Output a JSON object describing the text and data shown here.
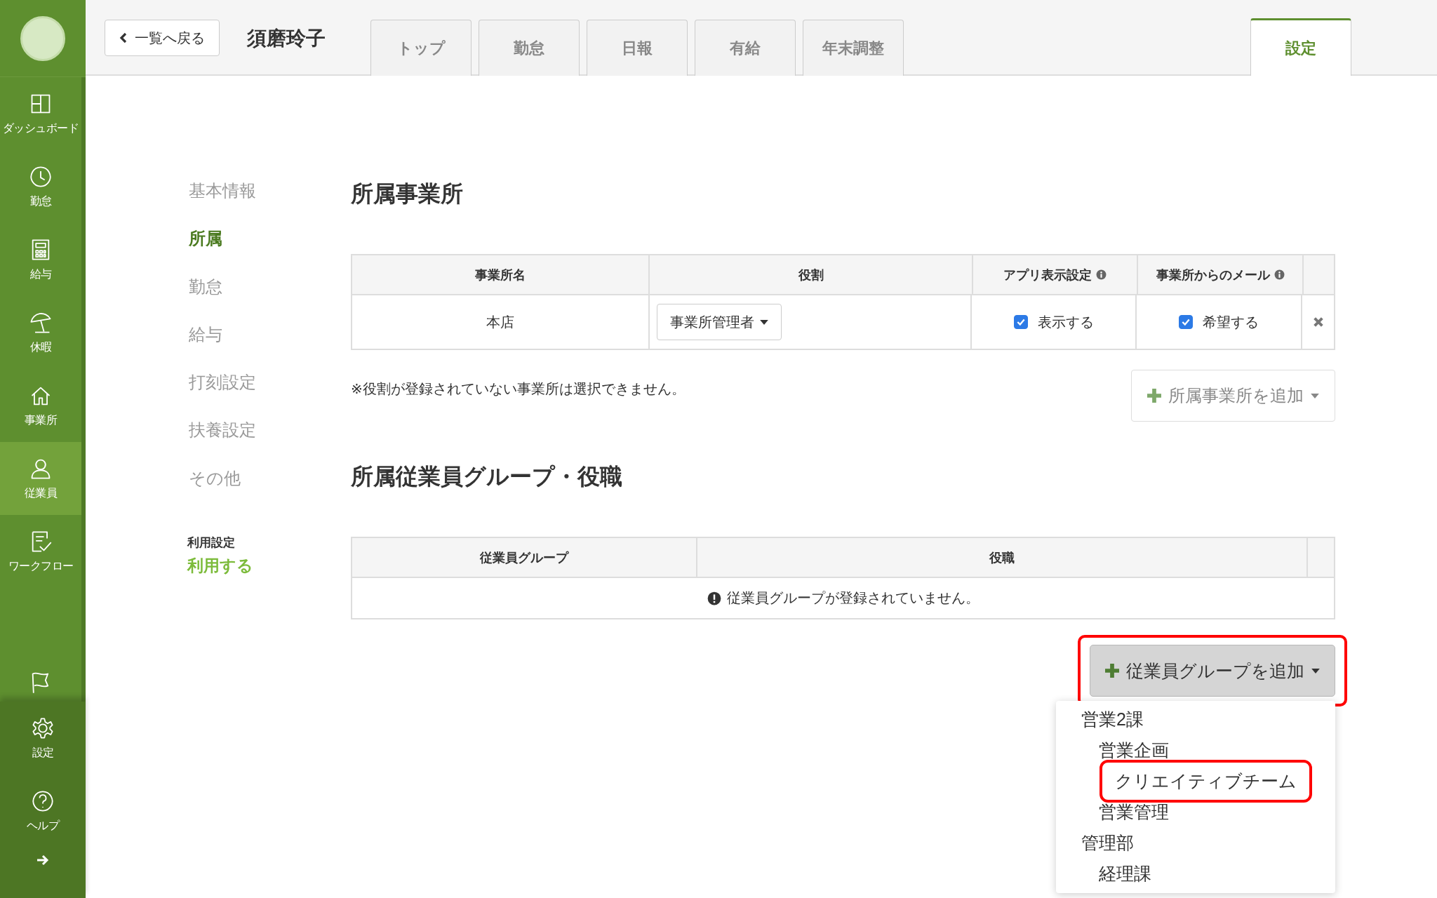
{
  "sidebar": {
    "items": [
      {
        "label": "ダッシュボード",
        "selected": false
      },
      {
        "label": "勤怠",
        "selected": false
      },
      {
        "label": "給与",
        "selected": false
      },
      {
        "label": "休暇",
        "selected": false
      },
      {
        "label": "事業所",
        "selected": false
      },
      {
        "label": "従業員",
        "selected": true
      },
      {
        "label": "ワークフロー",
        "selected": false
      }
    ],
    "bottom_items": [
      {
        "label": "設定"
      },
      {
        "label": "ヘルプ"
      }
    ]
  },
  "header": {
    "back_button": "一覧へ戻る",
    "employee_name": "須磨玲子",
    "tabs": [
      {
        "label": "トップ",
        "selected": false
      },
      {
        "label": "勤怠",
        "selected": false
      },
      {
        "label": "日報",
        "selected": false
      },
      {
        "label": "有給",
        "selected": false
      },
      {
        "label": "年末調整",
        "selected": false
      }
    ],
    "right_tabs": [
      {
        "label": "設定",
        "selected": true
      }
    ]
  },
  "settings_nav": {
    "items": [
      {
        "label": "基本情報",
        "selected": false
      },
      {
        "label": "所属",
        "selected": true
      },
      {
        "label": "勤怠",
        "selected": false
      },
      {
        "label": "給与",
        "selected": false
      },
      {
        "label": "打刻設定",
        "selected": false
      },
      {
        "label": "扶養設定",
        "selected": false
      },
      {
        "label": "その他",
        "selected": false
      }
    ],
    "usage_label": "利用設定",
    "usage_value": "利用する"
  },
  "offices": {
    "title": "所属事業所",
    "columns": [
      "事業所名",
      "役割",
      "アプリ表示設定",
      "事業所からのメール"
    ],
    "rows": [
      {
        "name": "本店",
        "role": "事業所管理者",
        "app_display": {
          "label": "表示する",
          "checked": true
        },
        "mail": {
          "label": "希望する",
          "checked": true
        }
      }
    ],
    "note": "※役割が登録されていない事業所は選択できません。",
    "add_button": "所属事業所を追加"
  },
  "groups": {
    "title": "所属従業員グループ・役職",
    "columns": [
      "従業員グループ",
      "役職"
    ],
    "empty_message": "従業員グループが登録されていません。",
    "add_button": "従業員グループを追加",
    "dropdown": [
      {
        "label": "営業2課",
        "highlighted": false,
        "children": [
          {
            "label": "営業企画",
            "highlighted": false,
            "children": [
              {
                "label": "クリエイティブチーム",
                "highlighted": true
              }
            ]
          },
          {
            "label": "営業管理",
            "highlighted": false
          }
        ]
      },
      {
        "label": "管理部",
        "highlighted": false,
        "children": [
          {
            "label": "経理課",
            "highlighted": false
          }
        ]
      }
    ]
  }
}
